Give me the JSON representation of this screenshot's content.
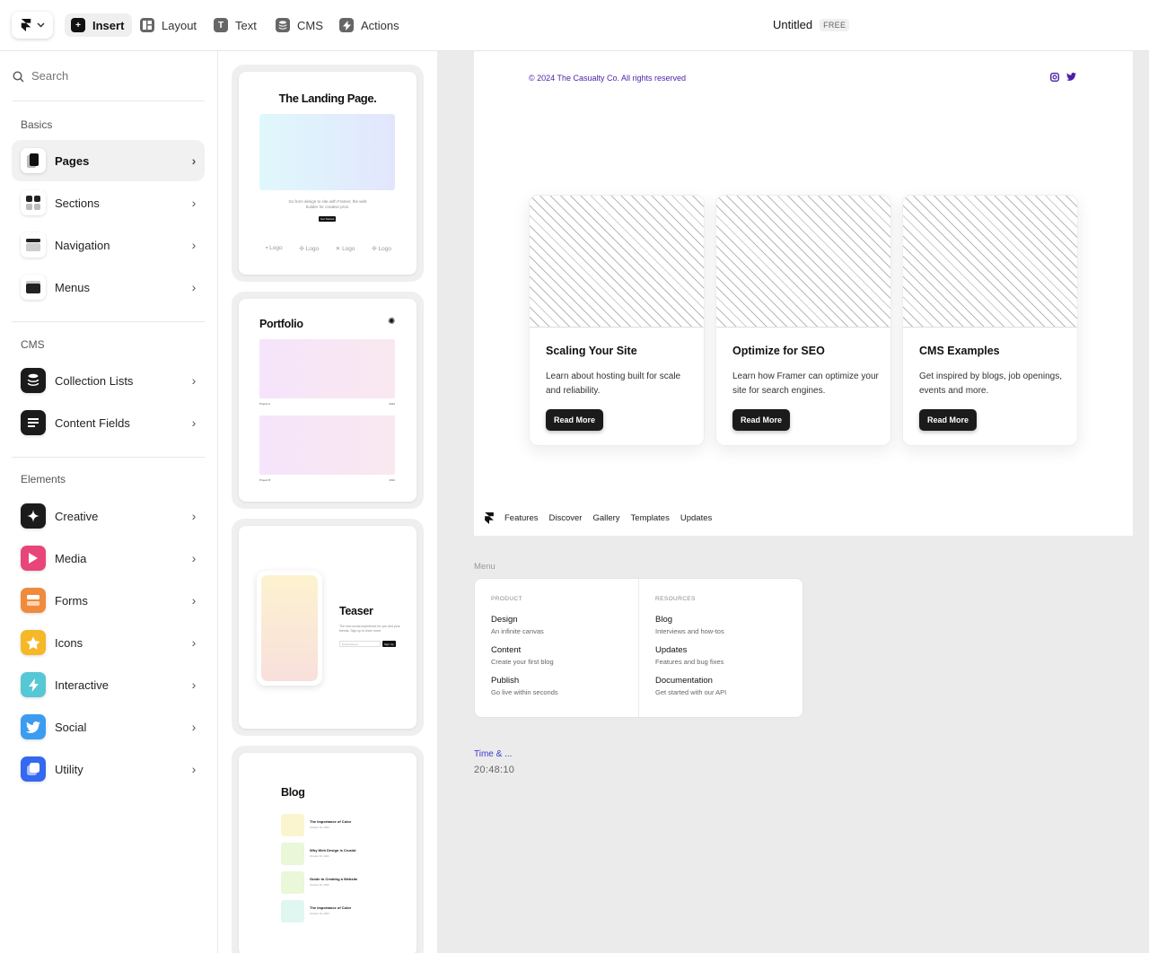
{
  "toolbar": {
    "tools": [
      "Insert",
      "Layout",
      "Text",
      "CMS",
      "Actions"
    ],
    "doc_title": "Untitled",
    "plan_badge": "FREE"
  },
  "sidebar": {
    "search_placeholder": "Search",
    "sections": {
      "basics": "Basics",
      "cms": "CMS",
      "elements": "Elements"
    },
    "basics_items": [
      "Pages",
      "Sections",
      "Navigation",
      "Menus"
    ],
    "cms_items": [
      "Collection Lists",
      "Content Fields"
    ],
    "element_items": [
      "Creative",
      "Media",
      "Forms",
      "Icons",
      "Interactive",
      "Social",
      "Utility"
    ],
    "colors": {
      "media": "#e8457a",
      "forms": "#f08a3c",
      "icons": "#f6b829",
      "interactive": "#56c7d4",
      "social": "#3c9cf0",
      "utility": "#3468f0"
    }
  },
  "templates": {
    "landing": {
      "title": "The Landing Page.",
      "desc": "Go from design to site with Framer, the web builder for creative pros.",
      "button": "Get Started",
      "logos": [
        "Logo",
        "Logo",
        "Logo",
        "Logo"
      ]
    },
    "portfolio": {
      "title": "Portfolio",
      "project1": "Project A",
      "project2": "Project B",
      "year": "2022"
    },
    "teaser": {
      "title": "Teaser",
      "desc": "The new social experience for you and your friends. Sign up to learn more.",
      "placeholder": "Email Address",
      "button": "Sign Up"
    },
    "blog": {
      "title": "Blog",
      "posts": [
        {
          "title": "The Importance of Color",
          "date": "October 10, 2023"
        },
        {
          "title": "Why Web Design is Crucial",
          "date": "October 10, 2023"
        },
        {
          "title": "Guide to Creating a Website",
          "date": "October 10, 2023"
        },
        {
          "title": "The Importance of Color",
          "date": "October 10, 2023"
        }
      ]
    }
  },
  "canvas": {
    "copyright": "© 2024 The Casualty Co. All rights reserved",
    "cards": [
      {
        "title": "Scaling Your Site",
        "desc": "Learn about hosting built for scale and reliability.",
        "button": "Read More"
      },
      {
        "title": "Optimize for SEO",
        "desc": "Learn how Framer can optimize your site for search engines.",
        "button": "Read More"
      },
      {
        "title": "CMS Examples",
        "desc": "Get inspired by blogs, job openings, events and more.",
        "button": "Read More"
      }
    ],
    "nav_links": [
      "Features",
      "Discover",
      "Gallery",
      "Templates",
      "Updates"
    ],
    "menu_label": "Menu",
    "menu": {
      "product_head": "PRODUCT",
      "resources_head": "RESOURCES",
      "product": [
        {
          "title": "Design",
          "sub": "An infinite canvas"
        },
        {
          "title": "Content",
          "sub": "Create your first blog"
        },
        {
          "title": "Publish",
          "sub": "Go live within seconds"
        }
      ],
      "resources": [
        {
          "title": "Blog",
          "sub": "Interviews and how-tos"
        },
        {
          "title": "Updates",
          "sub": "Features and bug fixes"
        },
        {
          "title": "Documentation",
          "sub": "Get started with our API"
        }
      ]
    },
    "time_label": "Time & ...",
    "time_value": "20:48:10",
    "accent_color": "#4a1fa8"
  }
}
